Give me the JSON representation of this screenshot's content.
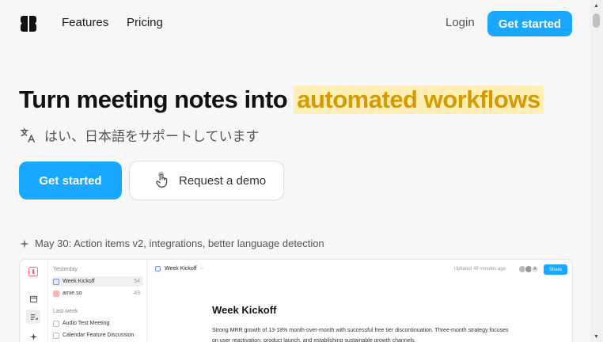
{
  "nav": {
    "links": [
      "Features",
      "Pricing"
    ],
    "login": "Login",
    "cta": "Get started"
  },
  "hero": {
    "title_plain": "Turn meeting notes into",
    "title_highlight": "automated workflows",
    "subtitle": "はい、日本語をサポートしています",
    "cta": "Get started",
    "demo": "Request a demo"
  },
  "announcement": "May 30: Action items v2, integrations, better language detection",
  "preview": {
    "sidebar": {
      "groups": [
        "Yesterday",
        "Last week"
      ],
      "items": [
        {
          "label": "Week Kickoff",
          "count": "54"
        },
        {
          "label": "amie.so",
          "count": "43"
        },
        {
          "label": "Audio Test Meeting",
          "count": ""
        },
        {
          "label": "Calendar Feature Discussion",
          "count": ""
        }
      ]
    },
    "doc_tab": "Week Kickoff",
    "updated": "Updated 49 minutes ago",
    "avatar_label": "A",
    "share": "Share",
    "doc_heading": "Week Kickoff",
    "doc_body": "Strong MRR growth of 13-18% month-over-month with successful free tier discontinuation. Three-month strategy focuses on user reactivation, product launch, and establishing sustainable growth channels."
  },
  "colors": {
    "accent": "#1aa7ff",
    "highlight_bg": "#fdefb5",
    "highlight_text": "#d69a00"
  },
  "icons": [
    "logo-icon",
    "translate-icon",
    "pointer-hand-icon",
    "sparkle-icon",
    "calendar-icon",
    "tasks-icon"
  ]
}
